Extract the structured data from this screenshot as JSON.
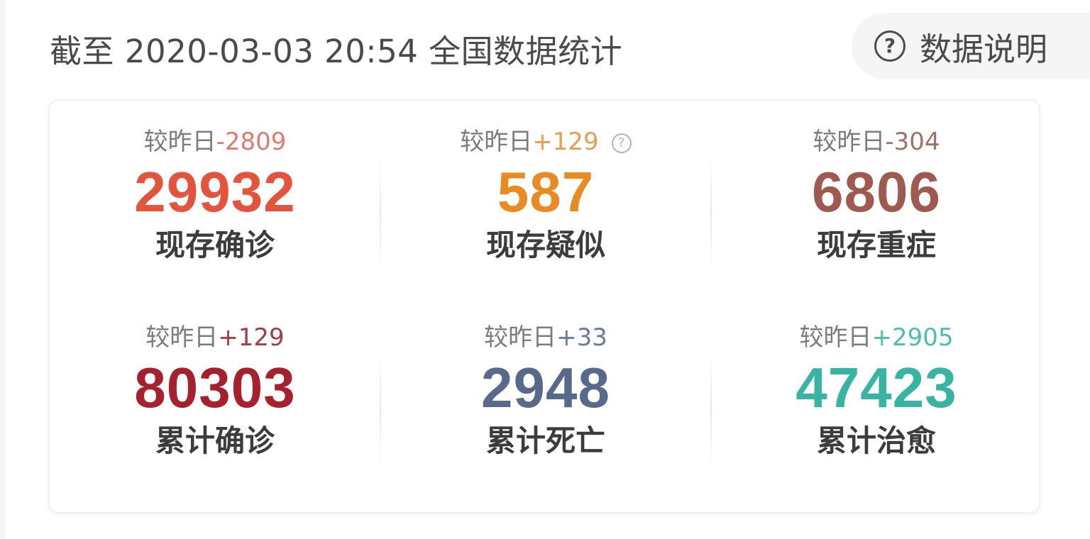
{
  "header": {
    "title_prefix": "截至",
    "timestamp": "2020-03-03 20:54",
    "title_suffix": "全国数据统计"
  },
  "explain_button": {
    "label": "数据说明",
    "icon": "question-circle-icon"
  },
  "stats": [
    {
      "delta_label": "较昨日",
      "delta_value": "-2809",
      "value": "29932",
      "label": "现存确诊",
      "color": "#e5533c",
      "delta_color": "#e07a6a"
    },
    {
      "delta_label": "较昨日",
      "delta_value": "+129",
      "value": "587",
      "label": "现存疑似",
      "color": "#ea8b22",
      "delta_color": "#e99e4e",
      "help_icon": "question-circle-icon"
    },
    {
      "delta_label": "较昨日",
      "delta_value": "-304",
      "value": "6806",
      "label": "现存重症",
      "color": "#a0594f",
      "delta_color": "#a66f66"
    },
    {
      "delta_label": "较昨日",
      "delta_value": "+129",
      "value": "80303",
      "label": "累计确诊",
      "color": "#a8202d",
      "delta_color": "#a83a45"
    },
    {
      "delta_label": "较昨日",
      "delta_value": "+33",
      "value": "2948",
      "label": "累计死亡",
      "color": "#586a8b",
      "delta_color": "#6b7c9b"
    },
    {
      "delta_label": "较昨日",
      "delta_value": "+2905",
      "value": "47423",
      "label": "累计治愈",
      "color": "#36b5a2",
      "delta_color": "#4bbfad"
    }
  ]
}
